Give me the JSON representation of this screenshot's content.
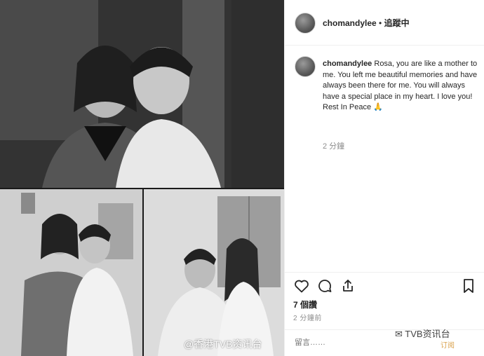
{
  "post": {
    "username": "chomandylee",
    "separator": " • ",
    "follow_status": "追蹤中",
    "caption_user": "chomandylee",
    "caption_text": "Rosa, you are like a mother to me. You left me beautiful memories and have always been there for me. You will always have a special place in my heart. I love you! Rest In Peace 🙏",
    "caption_timestamp": "2 分鐘",
    "likes": "7 個讚",
    "posted_ago": "2 分鐘前",
    "comment_placeholder": "留言……"
  },
  "icons": {
    "like": "heart-icon",
    "comment": "comment-icon",
    "share": "share-icon",
    "save": "bookmark-icon"
  },
  "watermarks": {
    "weibo": "@香港TVB资讯台",
    "wechat": "TVB资讯台",
    "wechat_sub": "订阅"
  },
  "colors": {
    "text": "#262626",
    "muted": "#8e8e8e",
    "divider": "#efefef"
  }
}
